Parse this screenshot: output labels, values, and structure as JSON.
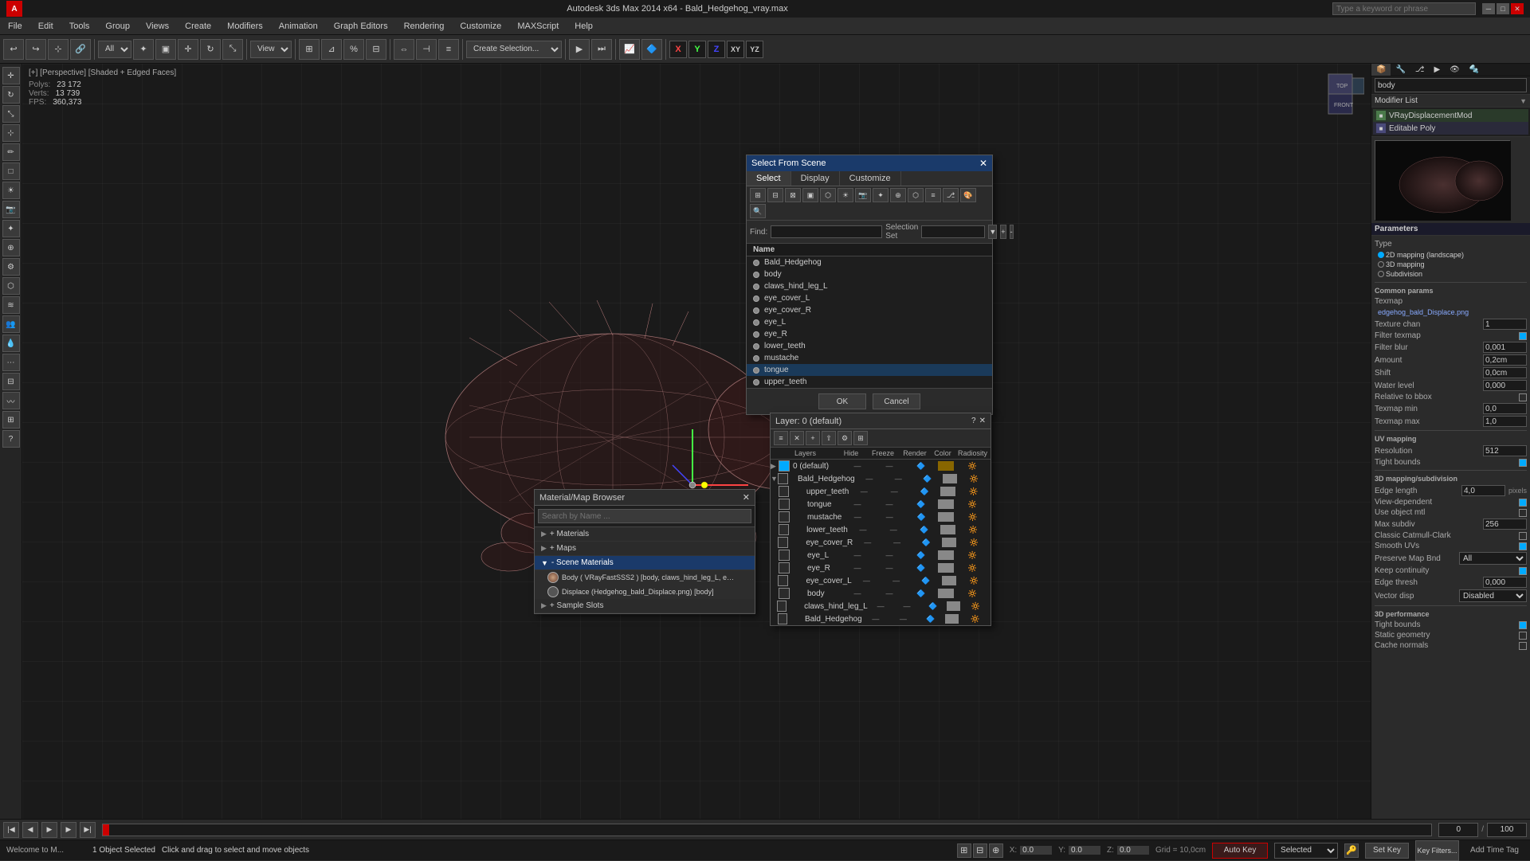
{
  "app": {
    "title": "Autodesk 3ds Max 2014 x64 - Bald_Hedgehog_vray.max",
    "logo": "A",
    "search_placeholder": "Type a keyword or phrase"
  },
  "menu": {
    "items": [
      "File",
      "Edit",
      "Tools",
      "Group",
      "Views",
      "Create",
      "Modifiers",
      "Animation",
      "Graph Editors",
      "Rendering",
      "Customize",
      "MAXScript",
      "Help"
    ]
  },
  "viewport": {
    "label": "[+] [Perspective] [Shaded + Edged Faces]",
    "stats": {
      "polys_label": "Polys:",
      "polys_value": "23 172",
      "verts_label": "Verts:",
      "verts_value": "13 739",
      "fps_label": "FPS:",
      "fps_value": "360,373"
    }
  },
  "toolbar": {
    "view_dropdown": "View",
    "create_selection_label": "Create Selection..."
  },
  "right_panel": {
    "title": "body",
    "modifier_list_label": "Modifier List",
    "modifiers": [
      {
        "name": "VRayDisplacementMod"
      },
      {
        "name": "Editable Poly"
      }
    ],
    "params_label": "Parameters",
    "type_label": "Type",
    "type_options": [
      "2D mapping (landscape)",
      "3D mapping",
      "Subdivision"
    ],
    "common_params_label": "Common params",
    "texmap_label": "Texmap",
    "texmap_value": "edgehog_bald_Displace.png",
    "texture_chan_label": "Texture chan",
    "texture_chan_value": "1",
    "filter_texmap_label": "Filter texmap",
    "filter_blur_label": "Filter blur",
    "filter_blur_value": "0,001",
    "amount_label": "Amount",
    "amount_value": "0,2cm",
    "shift_label": "Shift",
    "shift_value": "0,0cm",
    "water_level_label": "Water level",
    "water_level_value": "0,000",
    "relative_bbox_label": "Relative to bbox",
    "texmap_min_label": "Texmap min",
    "texmap_min_value": "0,0",
    "texmap_max_label": "Texmap max",
    "texmap_max_value": "1,0",
    "uv_mapping_label": "UV mapping",
    "resolution_label": "Resolution",
    "resolution_value": "512",
    "tight_bounds_label": "Tight bounds",
    "uv3d_label": "3D mapping/subdivision",
    "edge_length_label": "Edge length",
    "edge_length_value": "4,0",
    "pixels_label": "pixels",
    "view_dependent_label": "View-dependent",
    "use_obj_mtl_label": "Use object mtl",
    "max_subdiv_label": "Max subdiv",
    "max_subdiv_value": "256",
    "classic_cm_label": "Classic Catmull-Clark",
    "smooth_uvs_label": "Smooth UVs",
    "preserve_map_label": "Preserve Map Bnd",
    "preserve_map_value": "All",
    "keep_continuity_label": "Keep continuity",
    "edge_thresh_label": "Edge thresh",
    "edge_thresh_value": "0,000",
    "vector_disp_label": "Vector disp",
    "vector_disp_value": "Disabled",
    "uv3d_perf_label": "3D performance",
    "tight_bounds2_label": "Tight bounds",
    "static_geom_label": "Static geometry",
    "cache_normals_label": "Cache normals"
  },
  "select_scene_dialog": {
    "title": "Select From Scene",
    "tabs": [
      "Select",
      "Display",
      "Customize"
    ],
    "find_label": "Find:",
    "selection_set_label": "Selection Set",
    "name_header": "Name",
    "items": [
      {
        "name": "Bald_Hedgehog",
        "selected": false
      },
      {
        "name": "body",
        "selected": false
      },
      {
        "name": "claws_hind_leg_L",
        "selected": false
      },
      {
        "name": "eye_cover_L",
        "selected": false
      },
      {
        "name": "eye_cover_R",
        "selected": false
      },
      {
        "name": "eye_L",
        "selected": false
      },
      {
        "name": "eye_R",
        "selected": false
      },
      {
        "name": "lower_teeth",
        "selected": false
      },
      {
        "name": "mustache",
        "selected": false
      },
      {
        "name": "tongue",
        "selected": true
      },
      {
        "name": "upper_teeth",
        "selected": false
      }
    ],
    "ok_label": "OK",
    "cancel_label": "Cancel"
  },
  "layer_dialog": {
    "title": "Layer: 0 (default)",
    "columns": [
      "Layers",
      "Hide",
      "Freeze",
      "Render",
      "Color",
      "Radiosity"
    ],
    "layers": [
      {
        "name": "0 (default)",
        "level": 0,
        "is_default": true
      },
      {
        "name": "Bald_Hedgehog",
        "level": 1
      },
      {
        "name": "upper_teeth",
        "level": 2
      },
      {
        "name": "tongue",
        "level": 2
      },
      {
        "name": "mustache",
        "level": 2
      },
      {
        "name": "lower_teeth",
        "level": 2
      },
      {
        "name": "eye_cover_R",
        "level": 2
      },
      {
        "name": "eye_L",
        "level": 2
      },
      {
        "name": "eye_R",
        "level": 2
      },
      {
        "name": "eye_cover_L",
        "level": 2
      },
      {
        "name": "body",
        "level": 2
      },
      {
        "name": "claws_hind_leg_L",
        "level": 2
      },
      {
        "name": "Bald_Hedgehog",
        "level": 2
      }
    ]
  },
  "material_browser": {
    "title": "Material/Map Browser",
    "search_placeholder": "Search by Name ...",
    "categories": [
      {
        "label": "+ Materials",
        "expanded": false
      },
      {
        "label": "+ Maps",
        "expanded": false
      },
      {
        "label": "- Scene Materials",
        "expanded": true
      },
      {
        "label": "+ Sample Slots",
        "expanded": false
      }
    ],
    "scene_materials": [
      {
        "name": "Body  ( VRayFastSSS2 ) [body, claws_hind_leg_L, eye_cover_L, eye..."
      },
      {
        "name": "Displace (Hedgehog_bald_Displace.png) [body]"
      }
    ]
  },
  "status_bar": {
    "object_count": "1 Object Selected",
    "hint": "Click and drag to select and move objects",
    "x_label": "X:",
    "y_label": "Y:",
    "z_label": "",
    "grid_label": "Grid =",
    "grid_value": "10,0cm",
    "auto_key_label": "Auto Key",
    "selected_label": "Selected",
    "set_key_label": "Set Key",
    "add_time_tag_label": "Add Time Tag",
    "key_filters_label": "Key Filters..."
  },
  "anim_bar": {
    "frame_current": "0",
    "frame_max": "100"
  },
  "axis_labels": {
    "x": "X",
    "y": "Y",
    "z": "Z",
    "xy": "XY",
    "yz": "YZ"
  }
}
